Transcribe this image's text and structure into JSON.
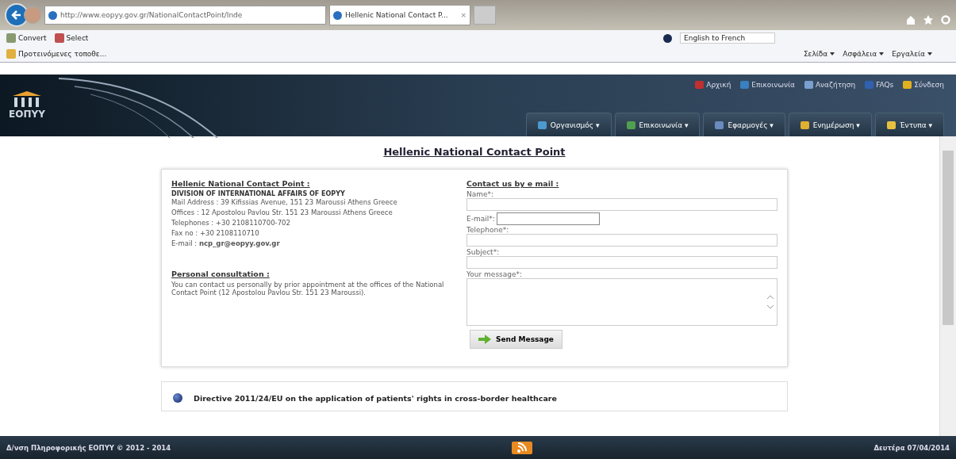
{
  "browser": {
    "address": "http://www.eopyy.gov.gr/NationalContactPoint/Inde",
    "tab": {
      "title": "Hellenic National Contact P...",
      "close": "×",
      "selected": true
    },
    "toolbar": {
      "convert": "Convert",
      "select": "Select",
      "translate": "English to French"
    },
    "favorites": {
      "item": "Προτεινόμενες τοποθε..."
    },
    "commands": [
      "Σελίδα",
      "Ασφάλεια",
      "Εργαλεία"
    ]
  },
  "site": {
    "logo": "ΕΟΠΥΥ",
    "top_links": [
      "Αρχική",
      "Επικοινωνία",
      "Αναζήτηση",
      "FAQs",
      "Σύνδεση"
    ],
    "menu": [
      {
        "label": "Οργανισμός",
        "caret": "▾"
      },
      {
        "label": "Επικοινωνία",
        "caret": "▾"
      },
      {
        "label": "Εφαρμογές",
        "caret": "▾"
      },
      {
        "label": "Ενημέρωση",
        "caret": "▾"
      },
      {
        "label": "Έντυπα",
        "caret": "▾"
      }
    ]
  },
  "page_title": "Hellenic National Contact Point",
  "contact": {
    "heading": "Hellenic National Contact Point :",
    "division": "DIVISION OF INTERNATIONAL AFFAIRS OF EOPYY",
    "lines": [
      "Mail Address : 39 Kifissias Avenue, 151 23 Maroussi Athens Greece",
      "Offices : 12 Apostolou Pavlou Str. 151 23 Maroussi Athens Greece",
      "Telephones : +30 2108110700-702",
      "Fax no : +30 2108110710",
      "E-mail : **ncp_gr@eopyy.gov.gr**"
    ],
    "consult_heading": "Personal consultation :",
    "consult_text": "You can contact us personally by prior appointment at the offices of the National Contact Point (12 Apostolou Pavlou Str. 151 23 Maroussi)."
  },
  "form": {
    "heading": "Contact us by e mail :",
    "fields": [
      {
        "label": "Name*:",
        "kind": "wide"
      },
      {
        "label": "E-mail*:",
        "kind": "inline"
      },
      {
        "label": "Telephone*:",
        "kind": "wide"
      },
      {
        "label": "Subject*:",
        "kind": "wide"
      },
      {
        "label": "Your message*:",
        "kind": "area"
      }
    ],
    "button": "Send Message"
  },
  "directive": "Directive 2011/24/EU on the application of patients' rights in cross-border healthcare",
  "footer": {
    "left": "Δ/νση Πληροφορικής ΕΟΠΥΥ © 2012 - 2014",
    "right": "Δευτέρα 07/04/2014"
  }
}
